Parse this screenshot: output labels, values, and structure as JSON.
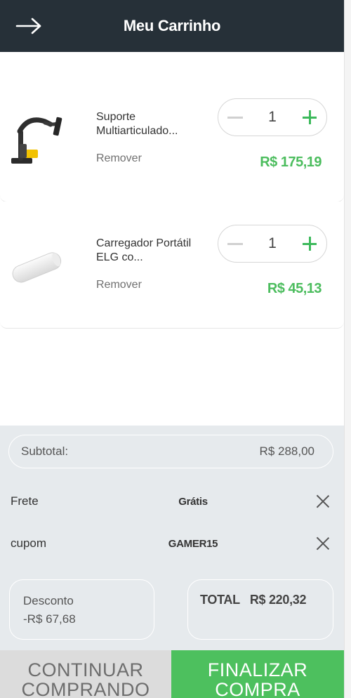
{
  "header": {
    "title": "Meu Carrinho",
    "back_icon": "arrow-right-icon"
  },
  "colors": {
    "header_bg": "#263038",
    "accent_green": "#4dc05e",
    "summary_bg": "#e6eaed"
  },
  "cart": {
    "items": [
      {
        "name": "Suporte Multiarticulado...",
        "quantity": "1",
        "remove_label": "Remover",
        "price": "R$ 175,19",
        "image": "monitor-arm-image"
      },
      {
        "name": "Carregador Portátil ELG co...",
        "quantity": "1",
        "remove_label": "Remover",
        "price": "R$ 45,13",
        "image": "power-bank-image"
      }
    ]
  },
  "summary": {
    "subtotal_label": "Subtotal:",
    "subtotal_value": "R$ 288,00",
    "shipping_label": "Frete",
    "shipping_value": "Grátis",
    "coupon_label": "cupom",
    "coupon_value": "GAMER15",
    "discount_label": "Desconto",
    "discount_value": "-R$ 67,68",
    "total_label": "TOTAL",
    "total_value": "R$ 220,32"
  },
  "actions": {
    "continue_line1": "CONTINUAR",
    "continue_line2": "COMPRANDO",
    "finish_line1": "FINALIZAR",
    "finish_line2": "COMPRA"
  }
}
